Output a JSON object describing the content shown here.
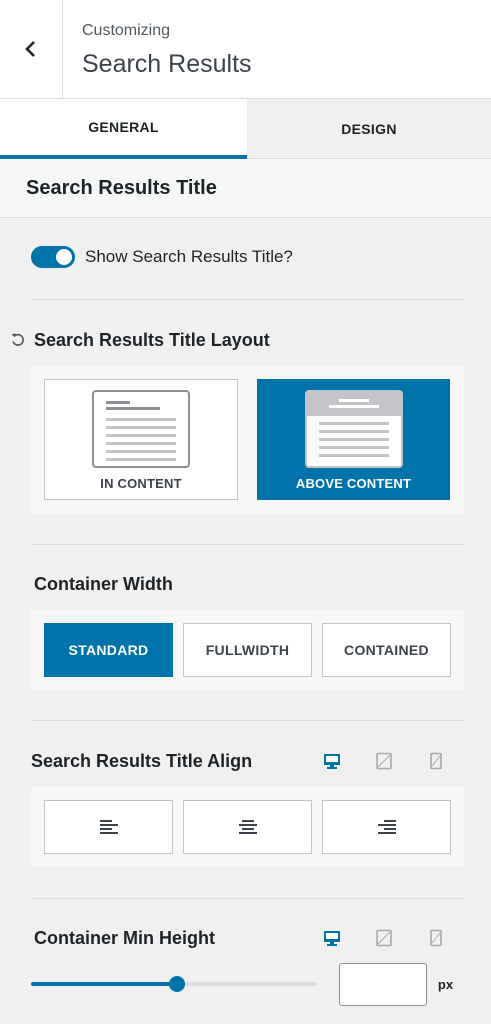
{
  "header": {
    "subtitle": "Customizing",
    "title": "Search Results"
  },
  "tabs": [
    {
      "label": "GENERAL",
      "active": true
    },
    {
      "label": "DESIGN",
      "active": false
    }
  ],
  "section": {
    "title": "Search Results Title"
  },
  "show_title": {
    "label": "Show Search Results Title?",
    "enabled": true
  },
  "layout": {
    "title": "Search Results Title Layout",
    "options": [
      {
        "label": "IN CONTENT",
        "selected": false
      },
      {
        "label": "ABOVE CONTENT",
        "selected": true
      }
    ]
  },
  "container_width": {
    "title": "Container Width",
    "options": [
      {
        "label": "STANDARD",
        "selected": true
      },
      {
        "label": "FULLWIDTH",
        "selected": false
      },
      {
        "label": "CONTAINED",
        "selected": false
      }
    ]
  },
  "title_align": {
    "title": "Search Results Title Align",
    "devices": [
      "desktop-icon",
      "tablet-icon",
      "mobile-icon"
    ],
    "active_device": "desktop",
    "options": [
      "align-left-icon",
      "align-center-icon",
      "align-right-icon"
    ]
  },
  "min_height": {
    "title": "Container Min Height",
    "devices": [
      "desktop-icon",
      "tablet-icon",
      "mobile-icon"
    ],
    "active_device": "desktop",
    "value": "",
    "slider_fraction": 0.51,
    "unit": "px"
  },
  "colors": {
    "accent": "#0073aa",
    "background": "#f0f0f1",
    "inactive_icon": "#a7aaad"
  }
}
